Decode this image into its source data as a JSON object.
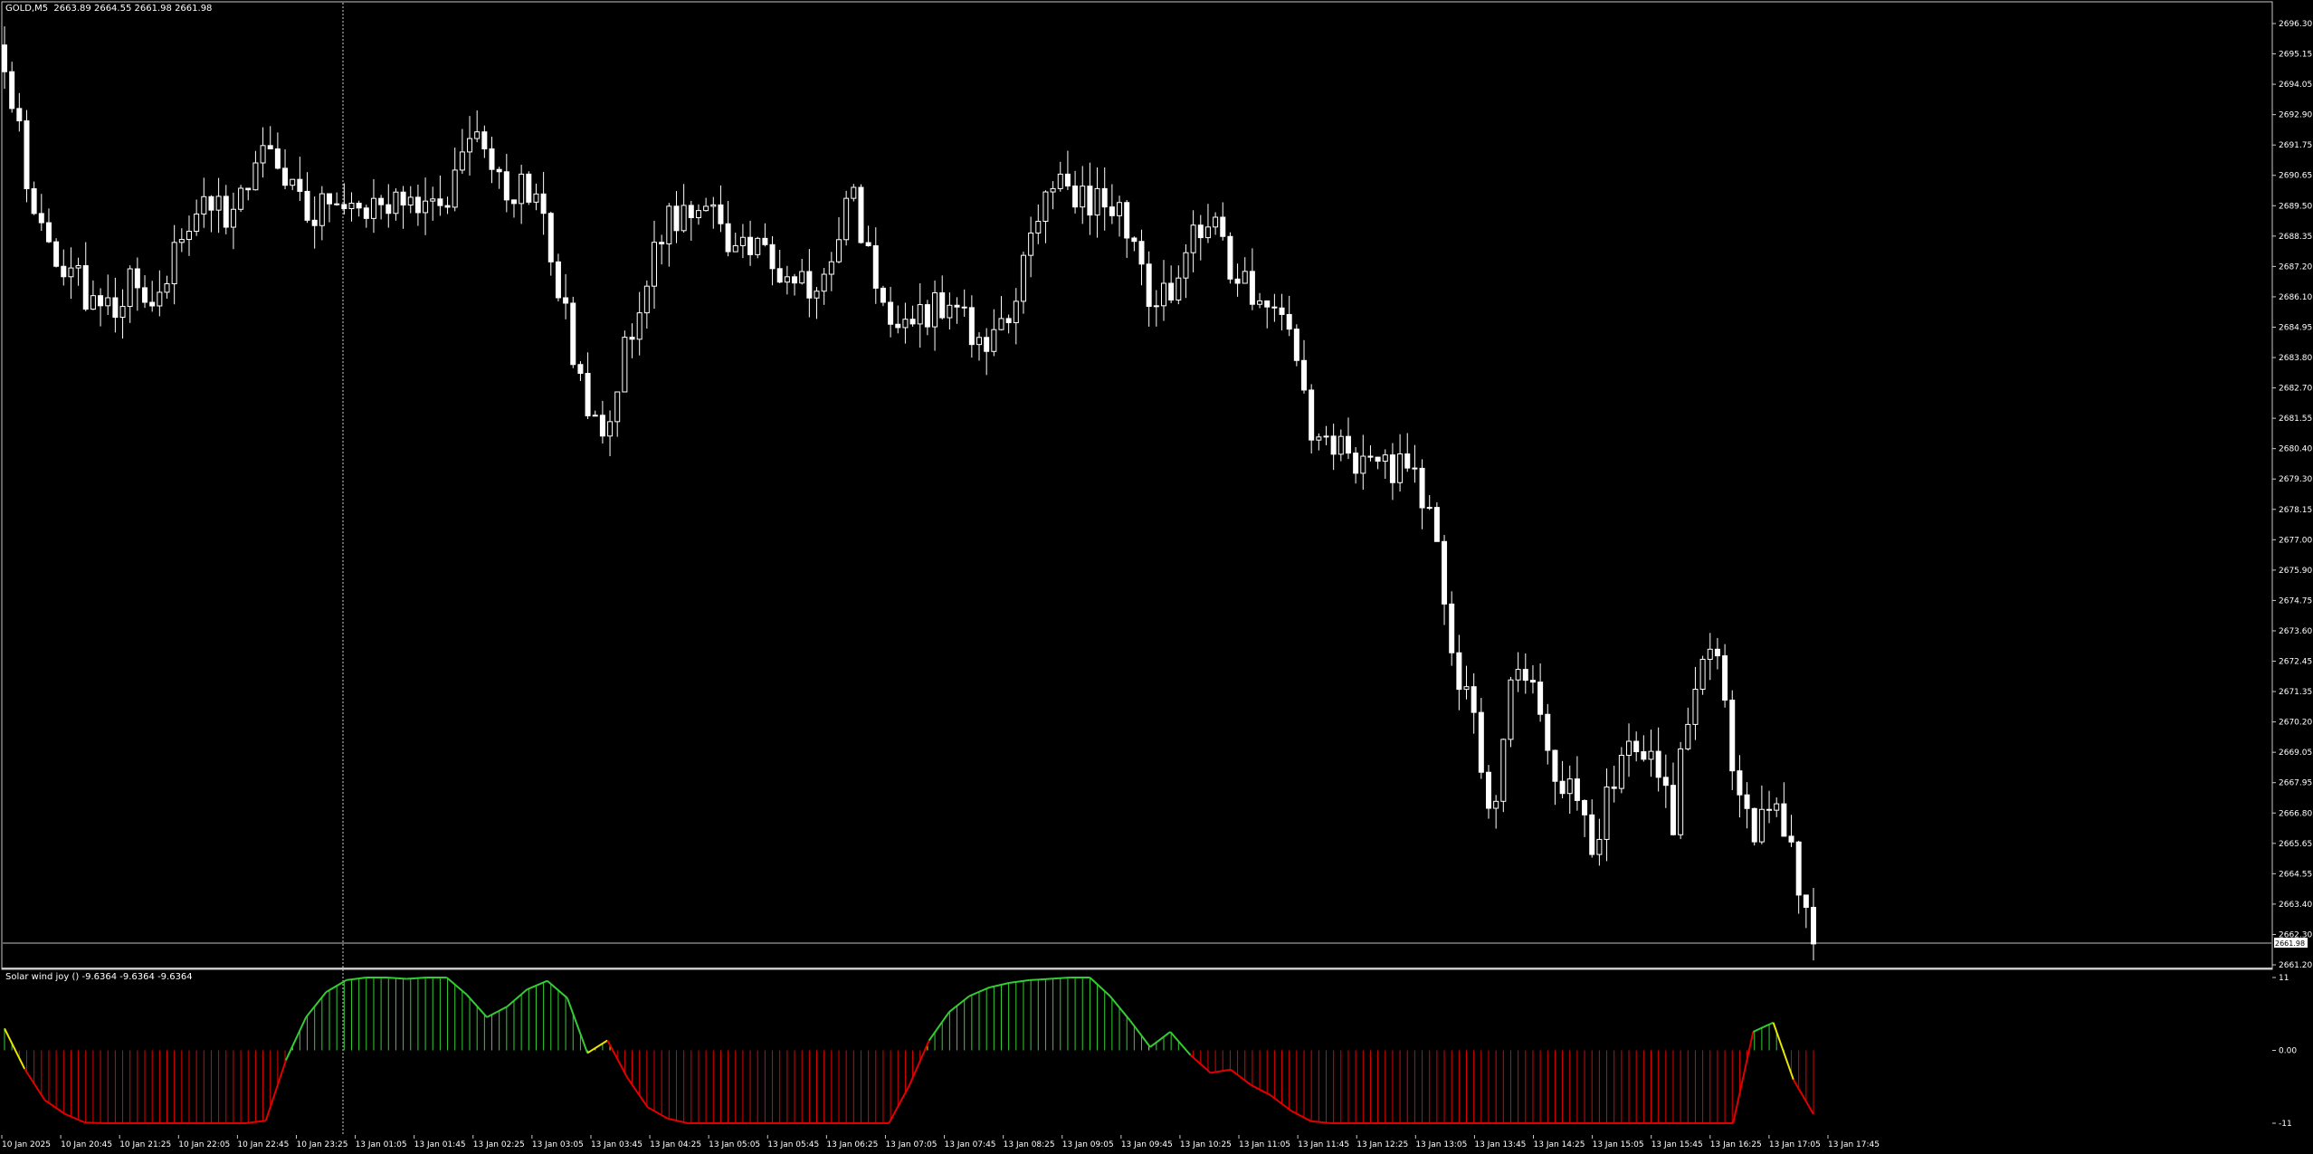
{
  "chart_data": [
    {
      "type": "candlestick",
      "symbol": "GOLD,M5",
      "ohlc_readout": [
        "2663.89",
        "2664.55",
        "2661.98",
        "2661.98"
      ],
      "last_price_label": "2661.98",
      "ylim": [
        2661.2,
        2696.3
      ],
      "y_tick_labels": [
        "2696.30",
        "2695.15",
        "2694.05",
        "2692.90",
        "2691.75",
        "2690.65",
        "2689.50",
        "2688.35",
        "2687.20",
        "2686.10",
        "2684.95",
        "2683.80",
        "2682.70",
        "2681.55",
        "2680.40",
        "2679.30",
        "2678.15",
        "2677.00",
        "2675.90",
        "2674.75",
        "2673.60",
        "2672.45",
        "2671.35",
        "2670.20",
        "2669.05",
        "2667.95",
        "2666.80",
        "2665.65",
        "2664.55",
        "2663.40",
        "2662.30",
        "2661.20"
      ],
      "x_tick_labels": [
        "10 Jan 2025",
        "10 Jan 20:45",
        "10 Jan 21:25",
        "10 Jan 22:05",
        "10 Jan 22:45",
        "10 Jan 23:25",
        "13 Jan 01:05",
        "13 Jan 01:45",
        "13 Jan 02:25",
        "13 Jan 03:05",
        "13 Jan 03:45",
        "13 Jan 04:25",
        "13 Jan 05:05",
        "13 Jan 05:45",
        "13 Jan 06:25",
        "13 Jan 07:05",
        "13 Jan 07:45",
        "13 Jan 08:25",
        "13 Jan 09:05",
        "13 Jan 09:45",
        "13 Jan 10:25",
        "13 Jan 11:05",
        "13 Jan 11:45",
        "13 Jan 12:25",
        "13 Jan 13:05",
        "13 Jan 13:45",
        "13 Jan 14:25",
        "13 Jan 15:05",
        "13 Jan 15:45",
        "13 Jan 16:25",
        "13 Jan 17:05",
        "13 Jan 17:45"
      ],
      "close_path": [
        2694.9,
        2691.0,
        2688.5,
        2687.3,
        2686.3,
        2685.2,
        2686.6,
        2686.1,
        2686.4,
        2688.8,
        2689.4,
        2689.3,
        2690.4,
        2692.6,
        2690.8,
        2689.5,
        2689.2,
        2689.7,
        2689.5,
        2688.9,
        2689.9,
        2689.6,
        2689.8,
        2692.7,
        2691.4,
        2689.7,
        2690.2,
        2688.4,
        2685.2,
        2681.4,
        2681.6,
        2684.5,
        2686.8,
        2689.2,
        2689.3,
        2689.1,
        2688.4,
        2688.0,
        2687.4,
        2686.5,
        2686.4,
        2687.3,
        2690.3,
        2687.3,
        2685.8,
        2685.4,
        2685.5,
        2685.8,
        2684.8,
        2684.2,
        2685.8,
        2688.3,
        2690.7,
        2690.1,
        2689.8,
        2689.4,
        2688.6,
        2686.0,
        2686.3,
        2688.5,
        2689.2,
        2687.2,
        2686.3,
        2685.4,
        2685.2,
        2681.0,
        2680.7,
        2680.1,
        2680.3,
        2679.7,
        2679.4,
        2678.1,
        2673.0,
        2670.3,
        2667.0,
        2671.8,
        2672.1,
        2668.5,
        2668.0,
        2665.4,
        2668.1,
        2670.1,
        2668.5,
        2666.6,
        2672.0,
        2673.0,
        2668.8,
        2666.3,
        2667.1,
        2665.4,
        2661.98
      ],
      "sample_high": [
        2691.3,
        2693.9,
        2690.8,
        2680.1,
        2689.2,
        2690.4
      ],
      "sample_low": [
        2684.5,
        2685.9,
        2679.5,
        2683.5,
        2677.6,
        2664.2
      ]
    },
    {
      "type": "histogram-oscillator",
      "name": "Solar wind joy ()",
      "values_readout": [
        "-9.6364",
        "-9.6364",
        "-9.6364"
      ],
      "ylim": [
        -11,
        11
      ],
      "y_tick_labels": [
        "11",
        "0.00",
        "-11"
      ],
      "series_x": [
        0,
        1,
        2,
        3,
        4,
        5,
        6,
        7,
        8,
        9,
        10,
        11,
        12,
        13,
        14,
        15,
        16,
        17,
        18,
        19,
        20,
        21,
        22,
        23,
        24,
        25,
        26,
        27,
        28,
        29,
        30,
        31,
        32,
        33,
        34,
        35,
        36,
        37,
        38,
        39,
        40,
        41,
        42,
        43,
        44,
        45,
        46,
        47,
        48,
        49,
        50,
        51,
        52,
        53,
        54,
        55,
        56,
        57,
        58,
        59,
        60,
        61,
        62,
        63,
        64,
        65,
        66,
        67,
        68,
        69,
        70,
        71,
        72,
        73,
        74,
        75,
        76,
        77,
        78,
        79,
        80,
        81,
        82,
        83,
        84,
        85,
        86,
        87,
        88,
        89,
        90
      ],
      "series_y": [
        3.3,
        -2.8,
        -7.5,
        -9.6,
        -10.9,
        -11,
        -11,
        -11,
        -11,
        -11,
        -11,
        -11,
        -11,
        -10.6,
        -1.5,
        5,
        8.8,
        10.6,
        11,
        11,
        10.8,
        11,
        11,
        8.4,
        5,
        6.6,
        9.2,
        10.5,
        7.9,
        -0.4,
        1.5,
        -4.2,
        -8.6,
        -10.3,
        -11,
        -11,
        -11,
        -11,
        -11,
        -11,
        -11,
        -11,
        -11,
        -11,
        -11,
        -5.4,
        1.5,
        5.8,
        8.2,
        9.5,
        10.2,
        10.6,
        10.8,
        11,
        11,
        8.2,
        4.5,
        0.5,
        2.8,
        -0.7,
        -3.4,
        -2.9,
        -5.2,
        -6.8,
        -9.1,
        -10.7,
        -11,
        -11,
        -11,
        -11,
        -11,
        -11,
        -11,
        -11,
        -11,
        -11,
        -11,
        -11,
        -11,
        -11,
        -11,
        -11,
        -11,
        -11,
        -11,
        -11,
        -11,
        2.8,
        4.2,
        -4.4,
        -9.6364
      ]
    }
  ]
}
